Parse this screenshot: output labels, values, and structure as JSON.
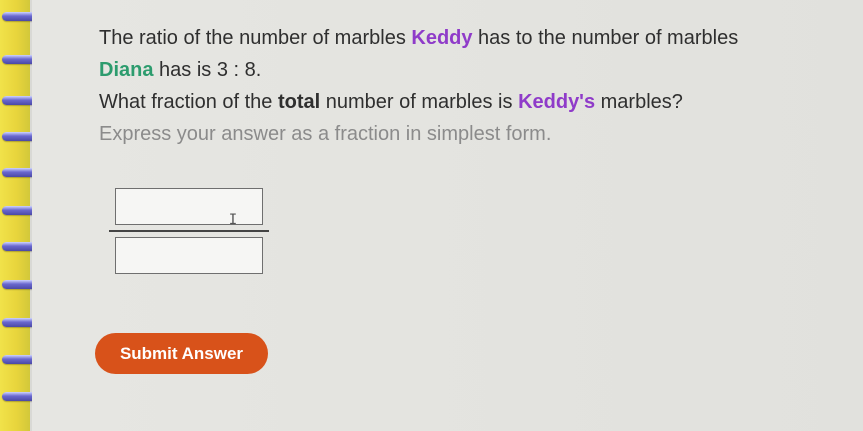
{
  "question": {
    "line1_prefix": "The ratio of the number of marbles ",
    "name1": "Keddy",
    "line1_suffix": " has to the number of marbles",
    "name2": "Diana",
    "line2_suffix": " has is ",
    "ratio": "3 : 8.",
    "line3_prefix": "What fraction of the ",
    "line3_bold": "total",
    "line3_middle": " number of marbles is ",
    "name1_possessive": "Keddy's",
    "line3_suffix": " marbles?",
    "instruction": "Express your answer as a fraction in simplest form."
  },
  "answer": {
    "numerator_value": "",
    "denominator_value": ""
  },
  "submit_label": "Submit Answer",
  "icons": {
    "cursor": "text-cursor-icon"
  },
  "colors": {
    "keddy": "#8f3bc9",
    "diana": "#2d9c6e",
    "submit_button": "#d8521a"
  }
}
